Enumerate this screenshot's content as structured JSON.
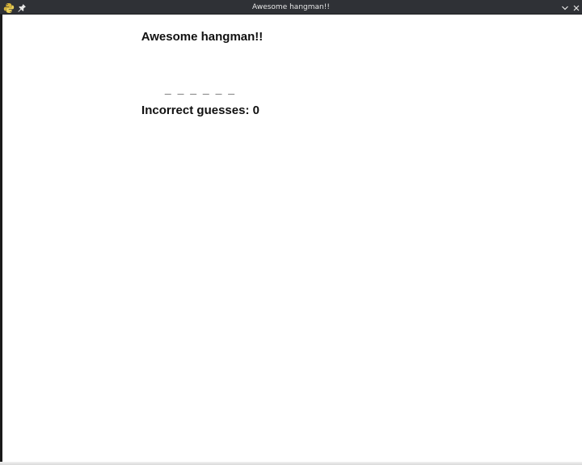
{
  "window": {
    "title": "Awesome hangman!!",
    "icons": {
      "app": "python-icon",
      "pin": "pin-icon",
      "minimize": "chevron-down-icon",
      "close": "close-icon"
    }
  },
  "game": {
    "heading": "Awesome hangman!!",
    "word_display": "_ _ _ _ _ _",
    "incorrect_guesses": "Incorrect guesses: 0"
  },
  "colors": {
    "titlebar": "#2f3136",
    "background": "#ffffff",
    "text": "#111111"
  }
}
